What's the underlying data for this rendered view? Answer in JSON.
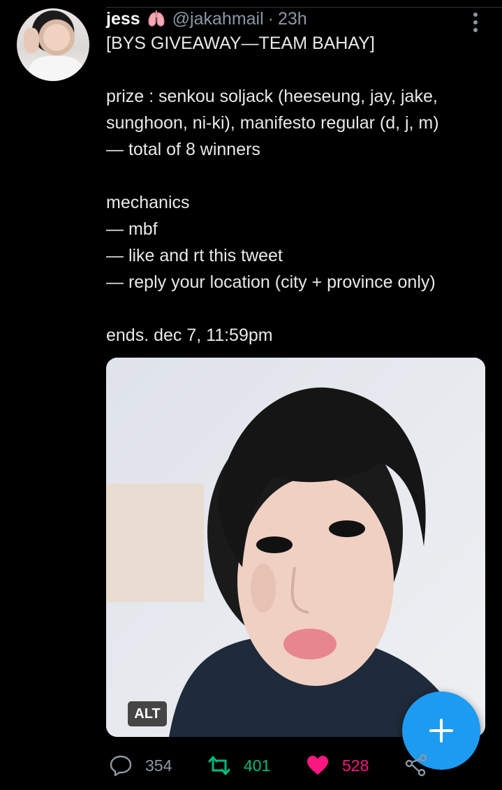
{
  "tweet": {
    "display_name": "jess",
    "name_emoji": "lungs-icon",
    "handle": "@jakahmail",
    "separator": "·",
    "time": "23h",
    "lines": {
      "l1": "[BYS GIVEAWAY—TEAM BAHAY]",
      "l2": "prize : senkou soljack (heeseung, jay, jake,",
      "l3": "sunghoon, ni-ki), manifesto regular (d, j, m)",
      "l4": "— total of 8 winners",
      "l5": "mechanics",
      "l6": "— mbf",
      "l7": "— like and rt this tweet",
      "l8": "— reply your location (city + province only)",
      "l9": "ends. dec 7, 11:59pm"
    },
    "media": {
      "alt_label": "ALT"
    },
    "stats": {
      "replies": "354",
      "retweets": "401",
      "likes": "528"
    }
  },
  "colors": {
    "background": "#000000",
    "text": "#e7e9ea",
    "muted": "#8b98a5",
    "retweet_green": "#00ba7c",
    "like_pink": "#f91880",
    "fab_blue": "#1d9bf0"
  },
  "icons": [
    "more-vertical-icon",
    "reply-icon",
    "retweet-icon",
    "heart-icon",
    "share-icon",
    "plus-icon",
    "lungs-icon"
  ]
}
